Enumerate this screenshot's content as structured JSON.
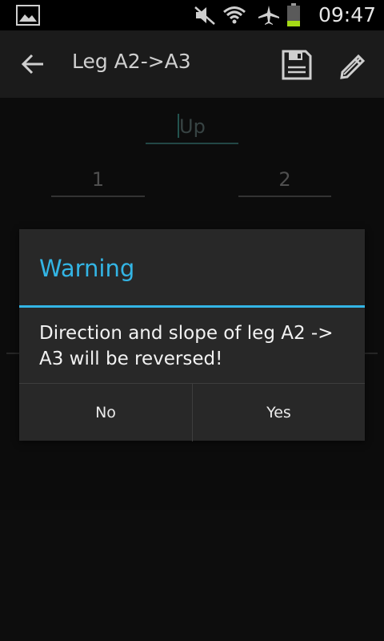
{
  "status_bar": {
    "time": "09:47",
    "icons": [
      "gallery-icon",
      "mute-icon",
      "wifi-icon",
      "airplane-icon",
      "battery-icon"
    ]
  },
  "app_bar": {
    "title": "Leg A2->A3",
    "back_icon": "back-arrow-icon",
    "save_icon": "save-icon",
    "edit_icon": "edit-icon"
  },
  "form": {
    "up_placeholder": "Up",
    "field_1": "1",
    "field_2": "2"
  },
  "dialog": {
    "title": "Warning",
    "message": "Direction and slope of leg  A2 -> A3 will be reversed!",
    "no_label": "No",
    "yes_label": "Yes"
  },
  "colors": {
    "accent": "#33b5e5",
    "background": "#111111",
    "dialog_bg": "#282828"
  }
}
